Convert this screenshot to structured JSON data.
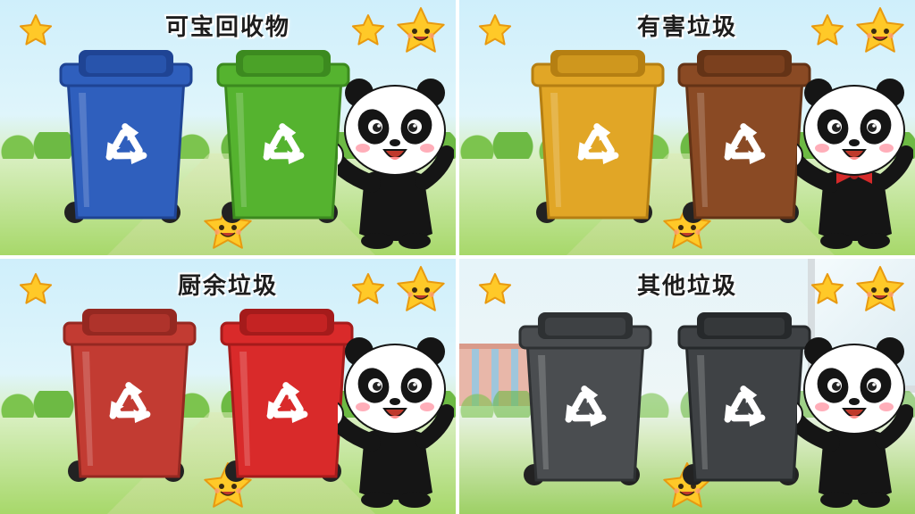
{
  "panels": [
    {
      "title": "可宝回收物",
      "bins": [
        {
          "color": "#2f5fbd",
          "dark": "#1f4494",
          "icon": "recycle-icon"
        },
        {
          "color": "#55b32f",
          "dark": "#3c8a1f",
          "icon": "recycle-icon"
        }
      ],
      "panda_bow_tie": false,
      "scene": "park"
    },
    {
      "title": "有害垃圾",
      "bins": [
        {
          "color": "#e1a626",
          "dark": "#b57f12",
          "icon": "recycle-icon"
        },
        {
          "color": "#8a4a24",
          "dark": "#643316",
          "icon": "recycle-icon"
        }
      ],
      "panda_bow_tie": true,
      "scene": "park"
    },
    {
      "title": "厨余垃圾",
      "bins": [
        {
          "color": "#c23b32",
          "dark": "#952821",
          "icon": "recycle-icon"
        },
        {
          "color": "#d92a2a",
          "dark": "#a51b1b",
          "icon": "recycle-icon"
        }
      ],
      "panda_bow_tie": false,
      "scene": "park"
    },
    {
      "title": "其他垃圾",
      "bins": [
        {
          "color": "#4a4d50",
          "dark": "#2e3133",
          "icon": "recycle-icon"
        },
        {
          "color": "#3f4245",
          "dark": "#26292b",
          "icon": "recycle-icon"
        }
      ],
      "panda_bow_tie": false,
      "scene": "schoolyard"
    }
  ],
  "colors": {
    "star": "#ffc928",
    "star_outline": "#e89a10",
    "divider": "#ffffff"
  }
}
